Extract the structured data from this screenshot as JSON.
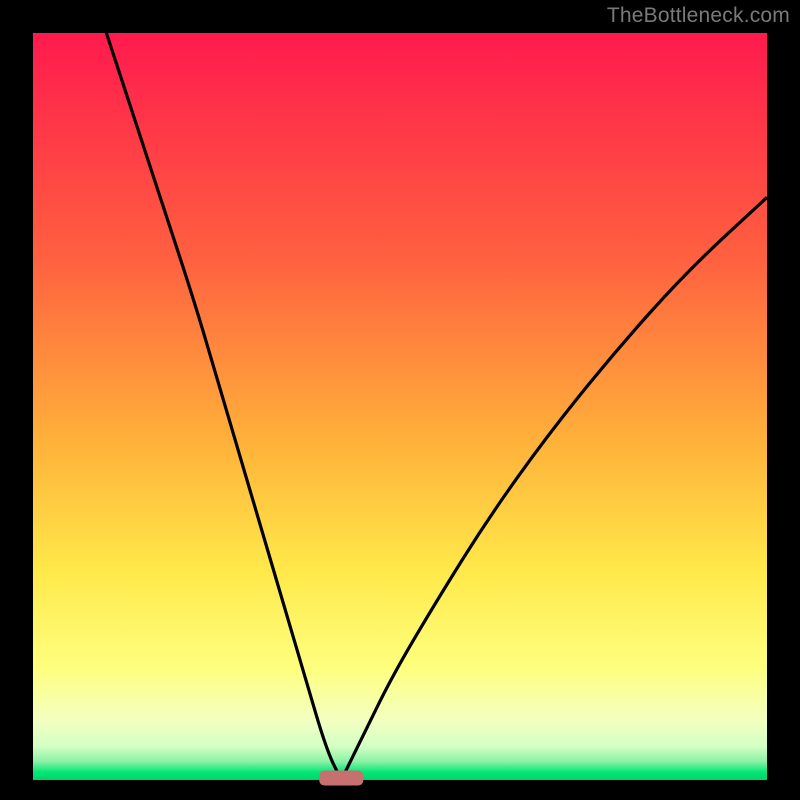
{
  "watermark": "TheBottleneck.com",
  "colors": {
    "bg_black": "#000000",
    "grad_top": "#ff1a4d",
    "grad_mid1": "#ff8f33",
    "grad_mid2": "#ffe94a",
    "grad_low": "#f6ffb0",
    "grad_green": "#00e676",
    "curve": "#000000",
    "marker": "#c77070"
  },
  "chart_data": {
    "type": "line",
    "title": "",
    "xlabel": "",
    "ylabel": "",
    "xlim": [
      0,
      100
    ],
    "ylim": [
      0,
      100
    ],
    "notch_x": 42,
    "left_curve": {
      "x": [
        10,
        14,
        18,
        22,
        25,
        28,
        31,
        34,
        37,
        40,
        42
      ],
      "y": [
        100,
        88,
        76,
        64,
        54,
        44,
        34,
        24,
        14,
        4,
        0
      ]
    },
    "right_curve": {
      "x": [
        42,
        45,
        49,
        55,
        62,
        70,
        79,
        89,
        100
      ],
      "y": [
        0,
        6,
        14,
        24,
        35,
        46,
        57,
        68,
        78
      ]
    },
    "marker": {
      "x": 42,
      "y": 0,
      "w": 6,
      "h": 2
    }
  }
}
